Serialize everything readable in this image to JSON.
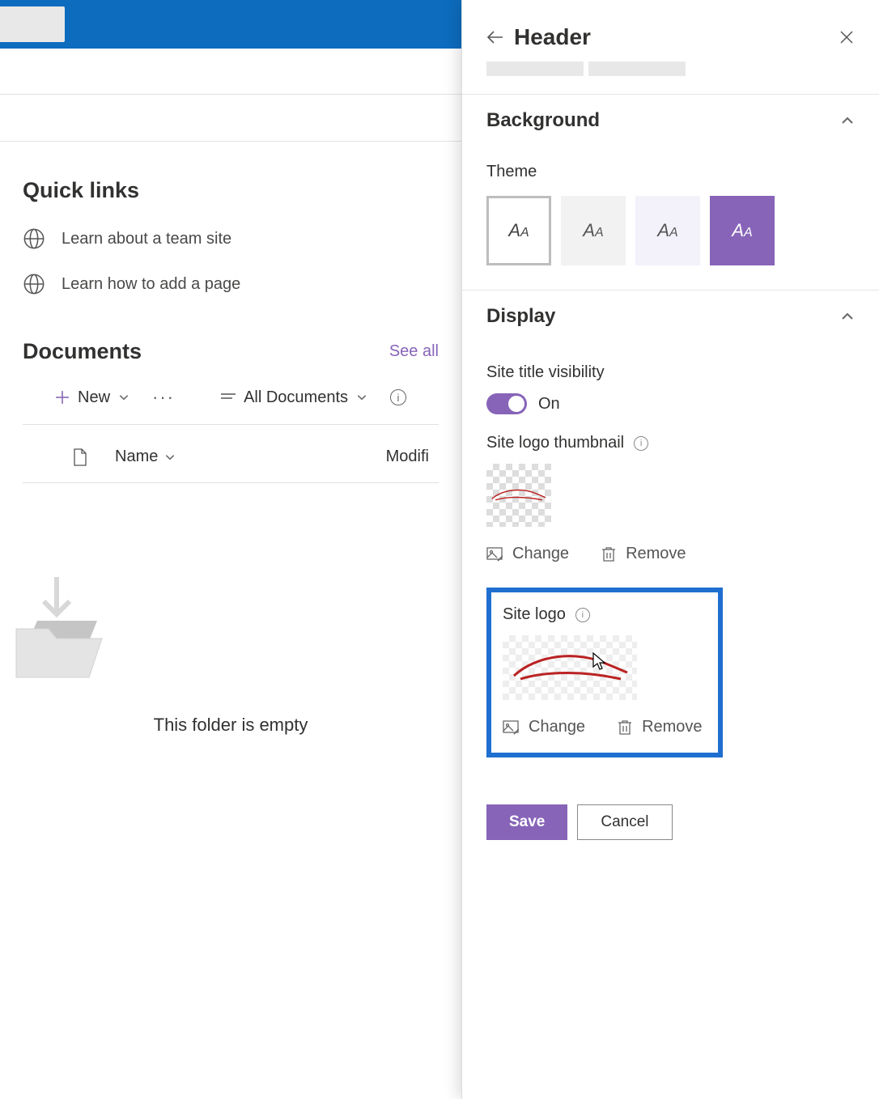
{
  "quickLinks": {
    "title": "Quick links",
    "items": [
      {
        "label": "Learn about a team site"
      },
      {
        "label": "Learn how to add a page"
      }
    ]
  },
  "documents": {
    "title": "Documents",
    "seeAll": "See all",
    "newLabel": "New",
    "viewLabel": "All Documents",
    "columns": {
      "name": "Name",
      "modified": "Modifi"
    },
    "emptyMessage": "This folder is empty"
  },
  "panel": {
    "title": "Header",
    "sections": {
      "background": "Background",
      "display": "Display"
    },
    "themeLabel": "Theme",
    "siteTitleVisibilityLabel": "Site title visibility",
    "siteTitleVisibilityState": "On",
    "siteLogoThumbnailLabel": "Site logo thumbnail",
    "siteLogoLabel": "Site logo",
    "changeLabel": "Change",
    "removeLabel": "Remove",
    "saveLabel": "Save",
    "cancelLabel": "Cancel"
  },
  "colors": {
    "accent": "#8764b8",
    "blueBar": "#0d6cbe",
    "highlight": "#1f6fd0"
  }
}
